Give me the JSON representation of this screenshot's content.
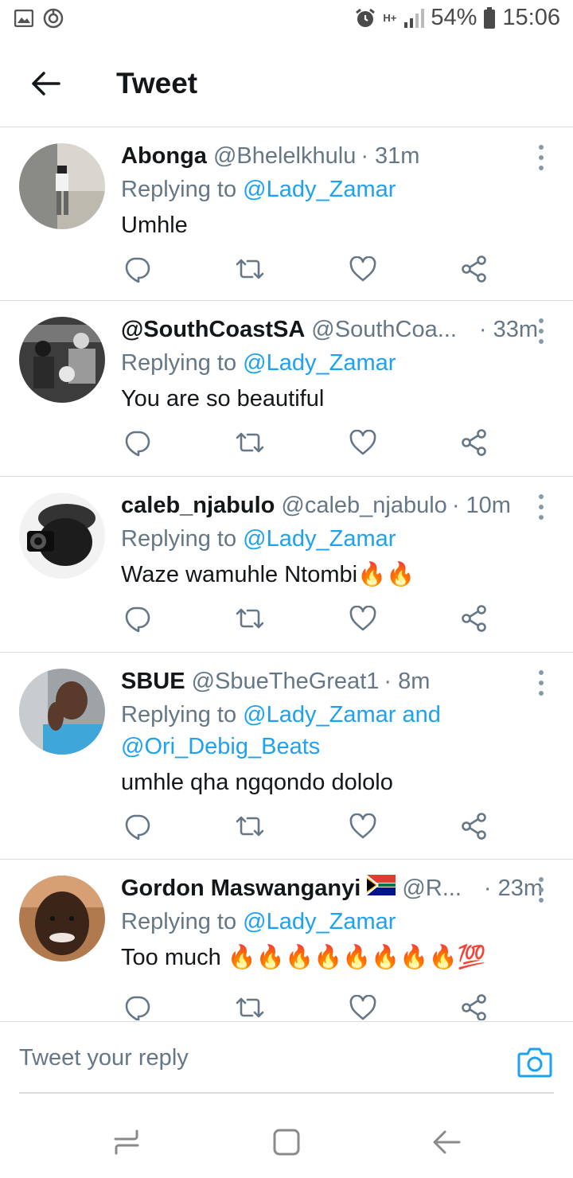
{
  "status_bar": {
    "battery": "54%",
    "time": "15:06",
    "network": "H+"
  },
  "header": {
    "title": "Tweet"
  },
  "tweets": [
    {
      "name": "Abonga",
      "handle": "@Bhelelkhulu",
      "time": "· 31m",
      "reply_prefix": "Replying to",
      "reply_mentions": "@Lady_Zamar",
      "reply_mentions_line2": "",
      "text": "Umhle"
    },
    {
      "name": "@SouthCoastSA",
      "handle": "@SouthCoa...",
      "time": "· 33m",
      "reply_prefix": "Replying to",
      "reply_mentions": "@Lady_Zamar",
      "reply_mentions_line2": "",
      "text": "You are so beautiful"
    },
    {
      "name": "caleb_njabulo",
      "handle": "@caleb_njabulo",
      "time": "· 10m",
      "reply_prefix": "Replying to",
      "reply_mentions": "@Lady_Zamar",
      "reply_mentions_line2": "",
      "text": "Waze wamuhle Ntombi🔥🔥"
    },
    {
      "name": "SBUE",
      "handle": "@SbueTheGreat1",
      "time": "· 8m",
      "reply_prefix": "Replying to",
      "reply_mentions": "@Lady_Zamar and",
      "reply_mentions_line2": "@Ori_Debig_Beats",
      "text": "umhle qha ngqondo dololo"
    },
    {
      "name": "Gordon Maswanganyi",
      "handle": "@R...",
      "time": "· 23m",
      "reply_prefix": "Replying to",
      "reply_mentions": "@Lady_Zamar",
      "reply_mentions_line2": "",
      "text": "Too much 🔥🔥🔥🔥🔥🔥🔥🔥💯"
    }
  ],
  "composer": {
    "placeholder": "Tweet your reply"
  },
  "colors": {
    "accent": "#1da1f2",
    "secondary_text": "#657786",
    "divider": "#d9dde1",
    "icon": "#657786"
  },
  "icons": {
    "reply": "reply-icon",
    "retweet": "retweet-icon",
    "like": "heart-icon",
    "share": "share-icon",
    "more": "more-vertical-icon",
    "camera": "camera-icon",
    "back": "arrow-left-icon"
  }
}
